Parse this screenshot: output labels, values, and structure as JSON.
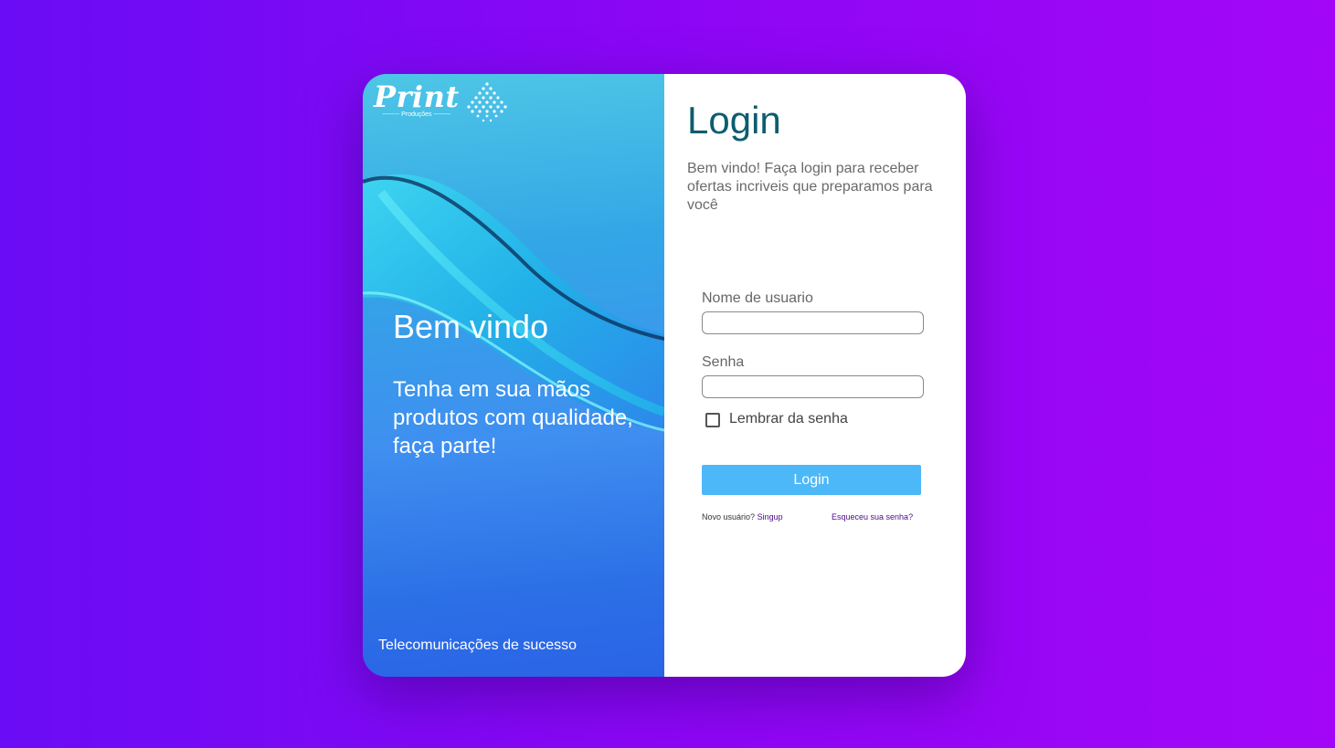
{
  "brand": {
    "name": "Print",
    "tagline": "-------- Produções --------"
  },
  "hero": {
    "title": "Bem vindo",
    "text": "Tenha em sua mãos produtos com qualidade, faça parte!",
    "footer": "Telecomunicações de sucesso"
  },
  "login": {
    "title": "Login",
    "subtitle": "Bem vindo! Faça login para receber ofertas incriveis que preparamos para você",
    "username_label": "Nome de usuario",
    "username_value": "",
    "password_label": "Senha",
    "password_value": "",
    "remember_label": "Lembrar da senha",
    "remember_checked": false,
    "button_label": "Login",
    "new_user_text": "Novo usuário?",
    "signup_link": "Singup",
    "forgot_link": "Esqueceu sua senha?"
  },
  "colors": {
    "background_start": "#6a0cf5",
    "background_end": "#a306f7",
    "login_title": "#0c5d6e",
    "button": "#4db8f7",
    "link": "#4b0a8a"
  }
}
